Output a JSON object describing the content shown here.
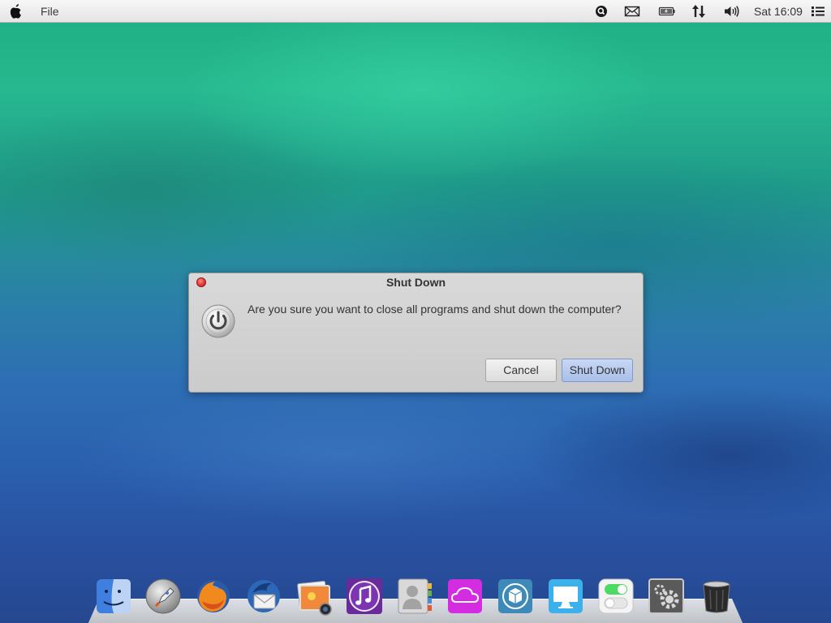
{
  "menubar": {
    "app_menu": "File",
    "clock": "Sat 16:09",
    "icons": [
      "apple-logo-icon",
      "search-icon",
      "mail-icon",
      "battery-icon",
      "network-transfer-icon",
      "volume-icon",
      "menu-list-icon"
    ]
  },
  "dialog": {
    "title": "Shut Down",
    "message": "Are you sure you want to close all programs and shut down the computer?",
    "cancel_label": "Cancel",
    "confirm_label": "Shut Down",
    "icon": "power-icon"
  },
  "dock": {
    "items": [
      "finder-icon",
      "launchpad-icon",
      "firefox-icon",
      "thunderbird-icon",
      "photos-icon",
      "music-icon",
      "contacts-icon",
      "cloud-icon",
      "package-icon",
      "display-icon",
      "toggle-settings-icon",
      "system-settings-icon",
      "trash-icon"
    ]
  },
  "colors": {
    "dialog_bg": "#d3d3d3",
    "primary_button": "#b4c8ef",
    "close_dot": "#e53935"
  }
}
